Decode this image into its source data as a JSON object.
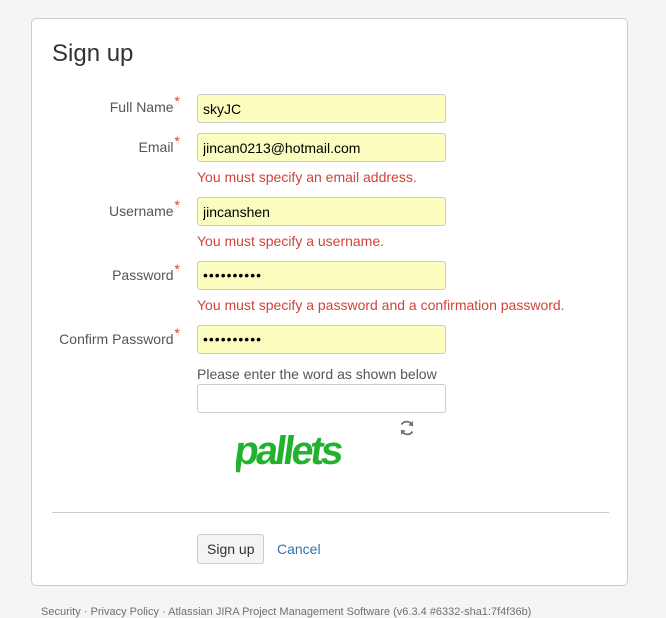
{
  "form": {
    "title": "Sign up",
    "fields": [
      {
        "label": "Full Name",
        "value": "skyJC"
      },
      {
        "label": "Email",
        "value": "jincan0213@hotmail.com",
        "error": "You must specify an email address."
      },
      {
        "label": "Username",
        "value": "jincanshen",
        "error": "You must specify a username."
      },
      {
        "label": "Password",
        "value": "••••••••••",
        "error": "You must specify a password and a confirmation password."
      },
      {
        "label": "Confirm Password",
        "value": "••••••••••"
      }
    ],
    "required_marker": "*",
    "captcha_hint": "Please enter the word as shown below",
    "captcha_value": "",
    "captcha_word": "pallets",
    "submit_label": "Sign up",
    "cancel_label": "Cancel"
  },
  "footer": {
    "text": "Security · Privacy Policy · Atlassian JIRA Project Management Software (v6.3.4 #6332-sha1:7f4f36b)"
  },
  "colors": {
    "error": "#d04437",
    "autofill_bg": "#fafdbd",
    "link": "#3572b0",
    "captcha_green": "#22b22f"
  }
}
